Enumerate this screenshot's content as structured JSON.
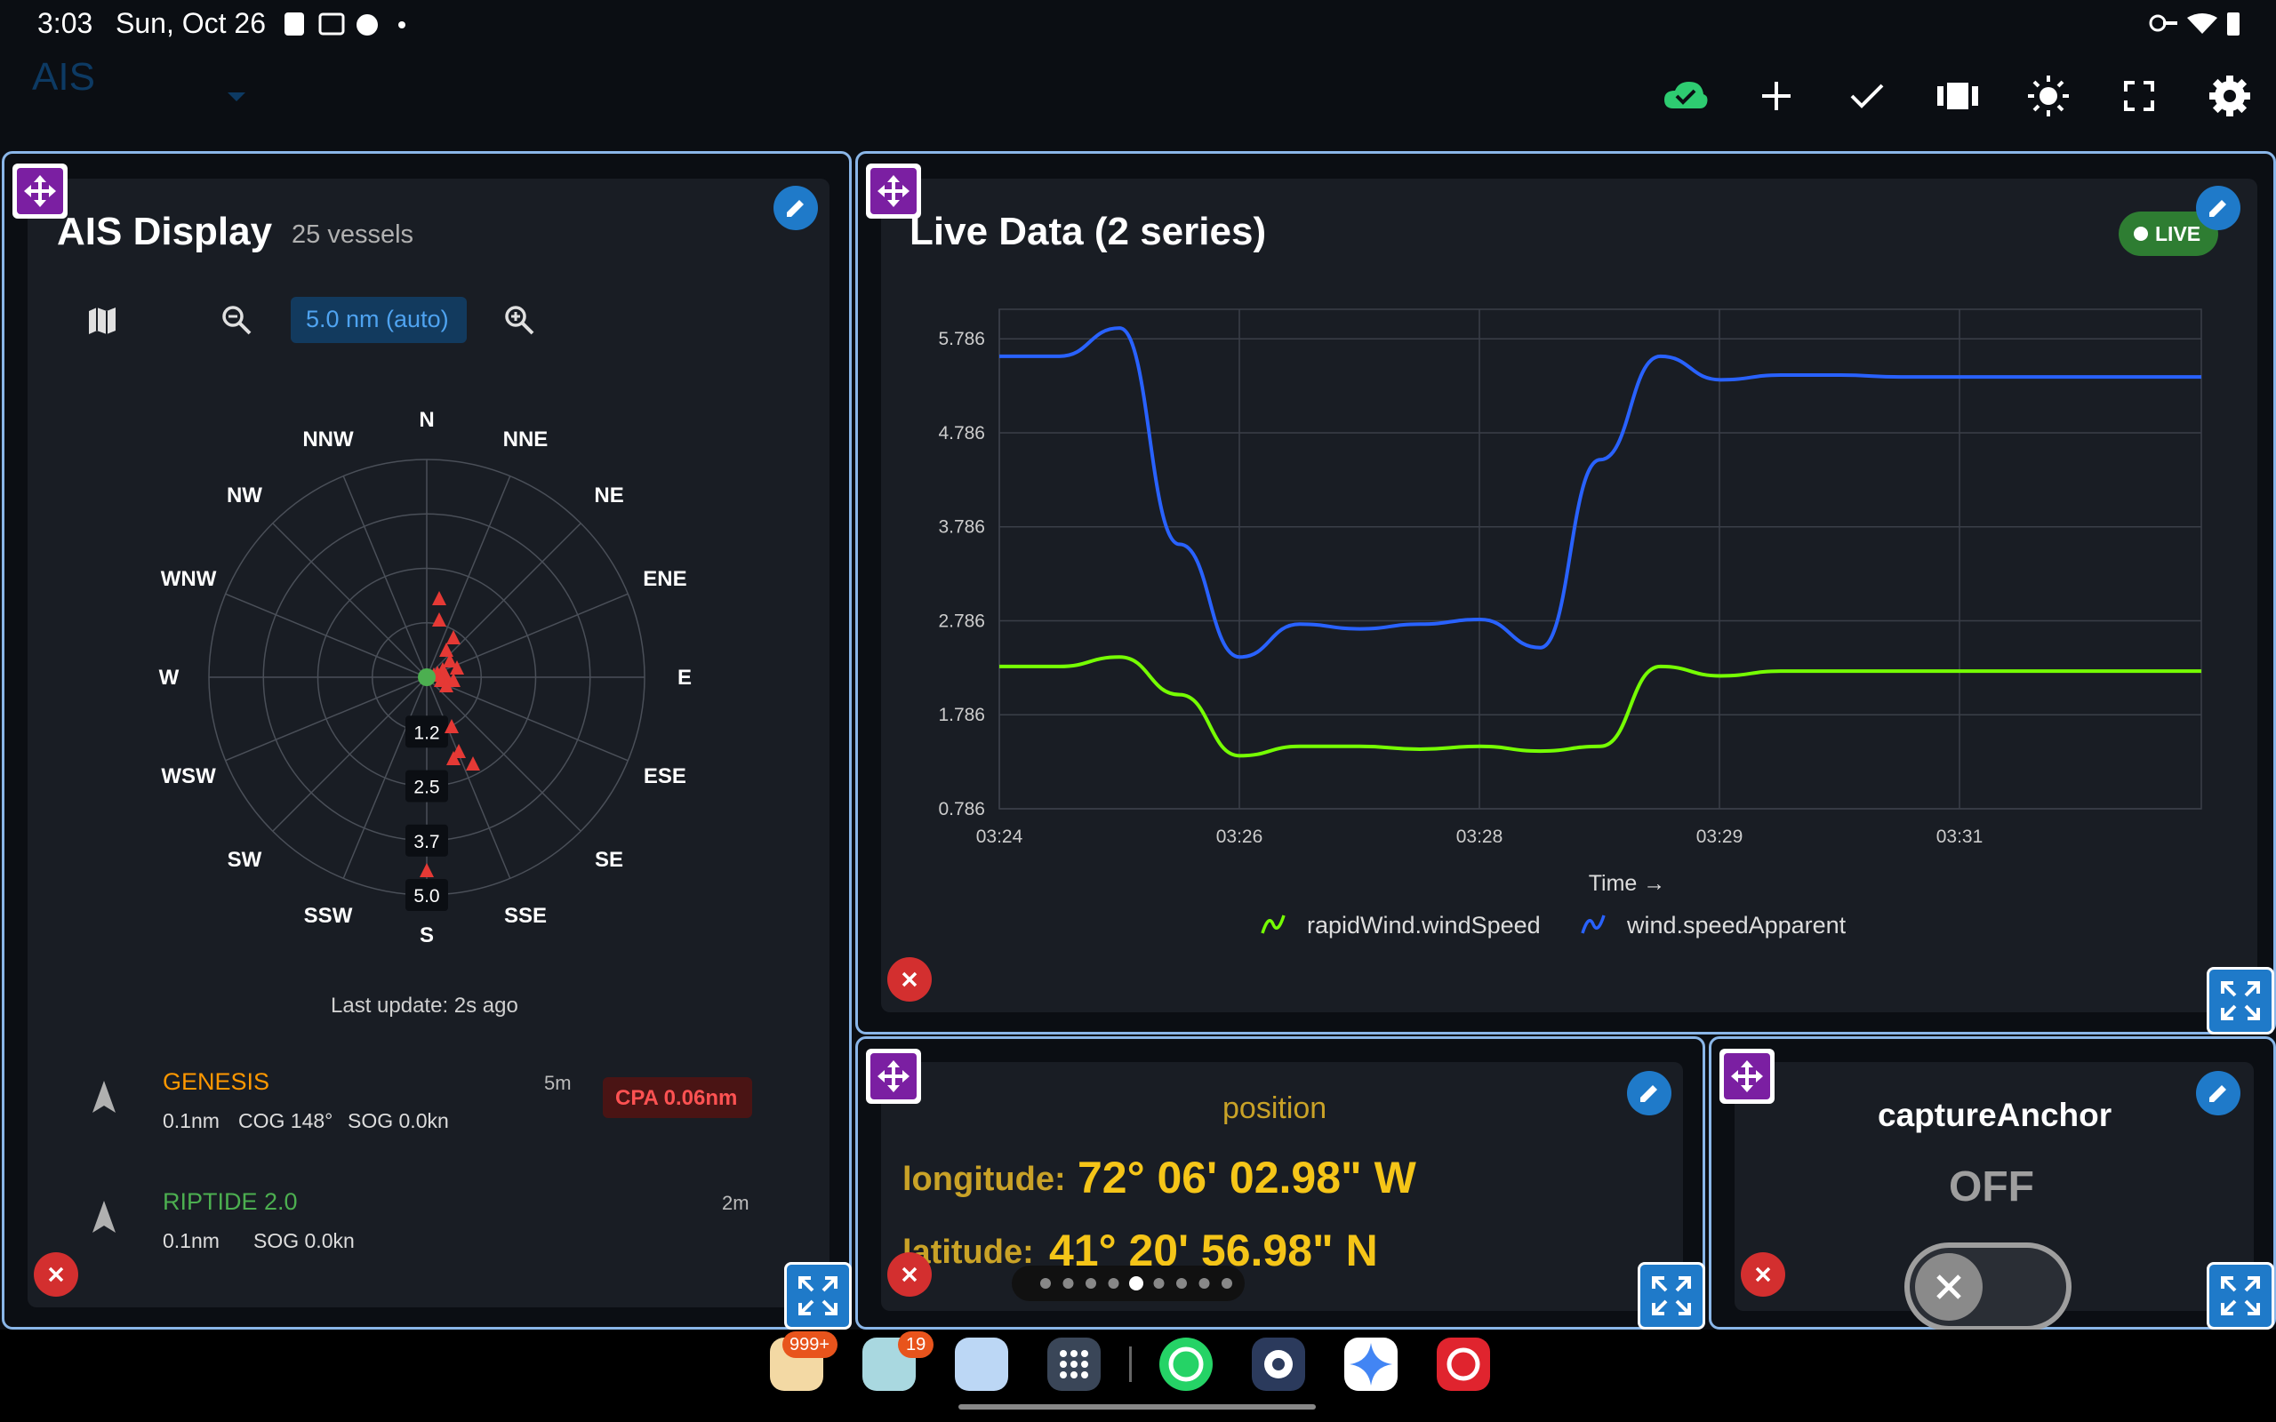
{
  "status_bar": {
    "time": "3:03",
    "date": "Sun, Oct 26"
  },
  "header": {
    "title": "AIS"
  },
  "colors": {
    "accent": "#1f7ac9",
    "move": "#7b1fa2",
    "close": "#d32f2f",
    "live": "#2e7d32",
    "series1": "#76ff03",
    "series2": "#2962ff",
    "cpa": "#e53935",
    "vessel_orange": "#ff9800",
    "vessel_green": "#4caf50"
  },
  "ais": {
    "title": "AIS Display",
    "count": "25 vessels",
    "range_label": "5.0 nm (auto)",
    "directions": [
      "N",
      "NNE",
      "NE",
      "ENE",
      "E",
      "ESE",
      "SE",
      "SSE",
      "S",
      "SSW",
      "SW",
      "WSW",
      "W",
      "WNW",
      "NW",
      "NNW"
    ],
    "ring_labels": [
      "1.2",
      "2.5",
      "3.7",
      "5.0"
    ],
    "last_update": "Last update: 2s ago",
    "vessels": [
      {
        "name": "GENESIS",
        "age": "5m",
        "dist": "0.1nm",
        "cog": "COG 148°",
        "sog": "SOG 0.0kn",
        "cpa": "CPA 0.06nm"
      },
      {
        "name": "RIPTIDE 2.0",
        "age": "2m",
        "dist": "0.1nm",
        "cog": "",
        "sog": "SOG 0.0kn",
        "cpa": ""
      }
    ]
  },
  "live": {
    "title": "Live Data (2 series)",
    "badge": "LIVE"
  },
  "chart_data": {
    "type": "line",
    "title": "Live Data (2 series)",
    "xlabel": "Time →",
    "ylabel": "",
    "x_ticks": [
      "03:24",
      "03:26",
      "03:28",
      "03:29",
      "03:31"
    ],
    "y_ticks": [
      "5.786",
      "4.786",
      "3.786",
      "2.786",
      "1.786",
      "0.786"
    ],
    "ylim": [
      0.786,
      6.1
    ],
    "x": [
      0,
      0.5,
      1.0,
      1.5,
      2.0,
      2.5,
      3.0,
      3.5,
      4.0,
      4.5,
      5.0,
      5.5,
      6.0,
      6.5,
      7.0,
      7.5,
      8.0,
      8.5,
      9.0,
      9.5,
      10.0
    ],
    "series": [
      {
        "name": "rapidWind.windSpeed",
        "color": "#76ff03",
        "values": [
          2.3,
          2.3,
          2.4,
          2.0,
          1.35,
          1.45,
          1.45,
          1.42,
          1.45,
          1.4,
          1.45,
          2.3,
          2.2,
          2.25,
          2.25,
          2.25,
          2.25,
          2.25,
          2.25,
          2.25,
          2.25
        ]
      },
      {
        "name": "wind.speedApparent",
        "color": "#2962ff",
        "values": [
          5.6,
          5.6,
          5.9,
          3.6,
          2.4,
          2.75,
          2.7,
          2.75,
          2.8,
          2.5,
          4.5,
          5.6,
          5.35,
          5.4,
          5.4,
          5.38,
          5.38,
          5.38,
          5.38,
          5.38,
          5.38
        ]
      }
    ]
  },
  "position": {
    "title": "position",
    "lon_label": "longitude:",
    "lon_value": "72° 06' 02.98\" W",
    "lat_label": "latitude:",
    "lat_value": "41° 20' 56.98\" N"
  },
  "anchor": {
    "title": "captureAnchor",
    "state": "OFF"
  },
  "dock": {
    "badges": [
      "999+",
      "19"
    ]
  }
}
